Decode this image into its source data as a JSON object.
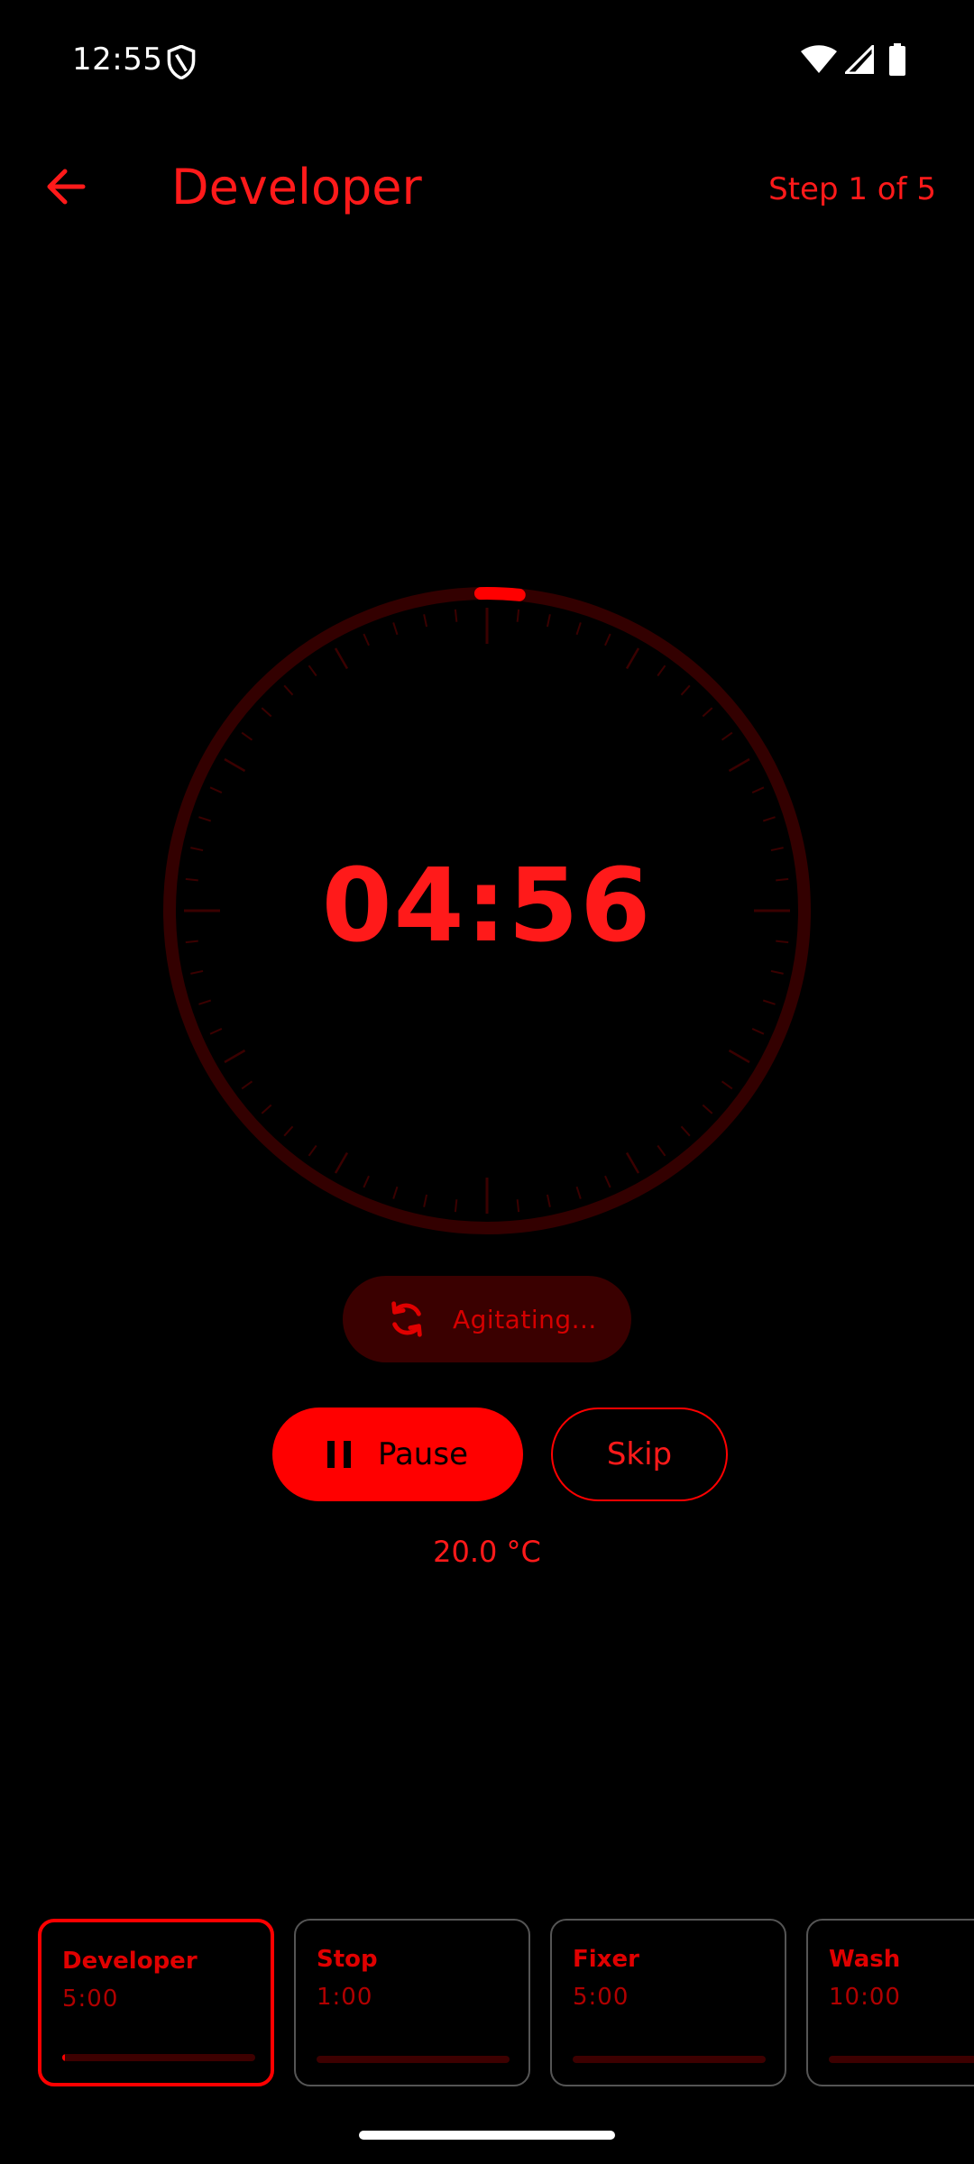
{
  "status_bar": {
    "time": "12:55",
    "icons": [
      "shield-icon",
      "wifi-icon",
      "signal-icon",
      "battery-icon"
    ]
  },
  "header": {
    "title": "Developer",
    "step_indicator": "Step 1 of 5",
    "back_icon": "arrow-left-icon"
  },
  "timer": {
    "remaining": "04:56",
    "progress_fraction": 0.013
  },
  "agitation": {
    "label": "Agitating...",
    "icon": "sync-icon"
  },
  "controls": {
    "pause_label": "Pause",
    "pause_icon": "pause-icon",
    "skip_label": "Skip"
  },
  "temperature": "20.0 °C",
  "steps": [
    {
      "name": "Developer",
      "duration": "5:00",
      "progress": 0.013,
      "active": true
    },
    {
      "name": "Stop",
      "duration": "1:00",
      "progress": 0,
      "active": false
    },
    {
      "name": "Fixer",
      "duration": "5:00",
      "progress": 0,
      "active": false
    },
    {
      "name": "Wash",
      "duration": "10:00",
      "progress": 0,
      "active": false
    }
  ],
  "colors": {
    "accent": "#ff0000",
    "background": "#000000",
    "dial_track": "#330000",
    "pill_background": "#3a0000"
  }
}
